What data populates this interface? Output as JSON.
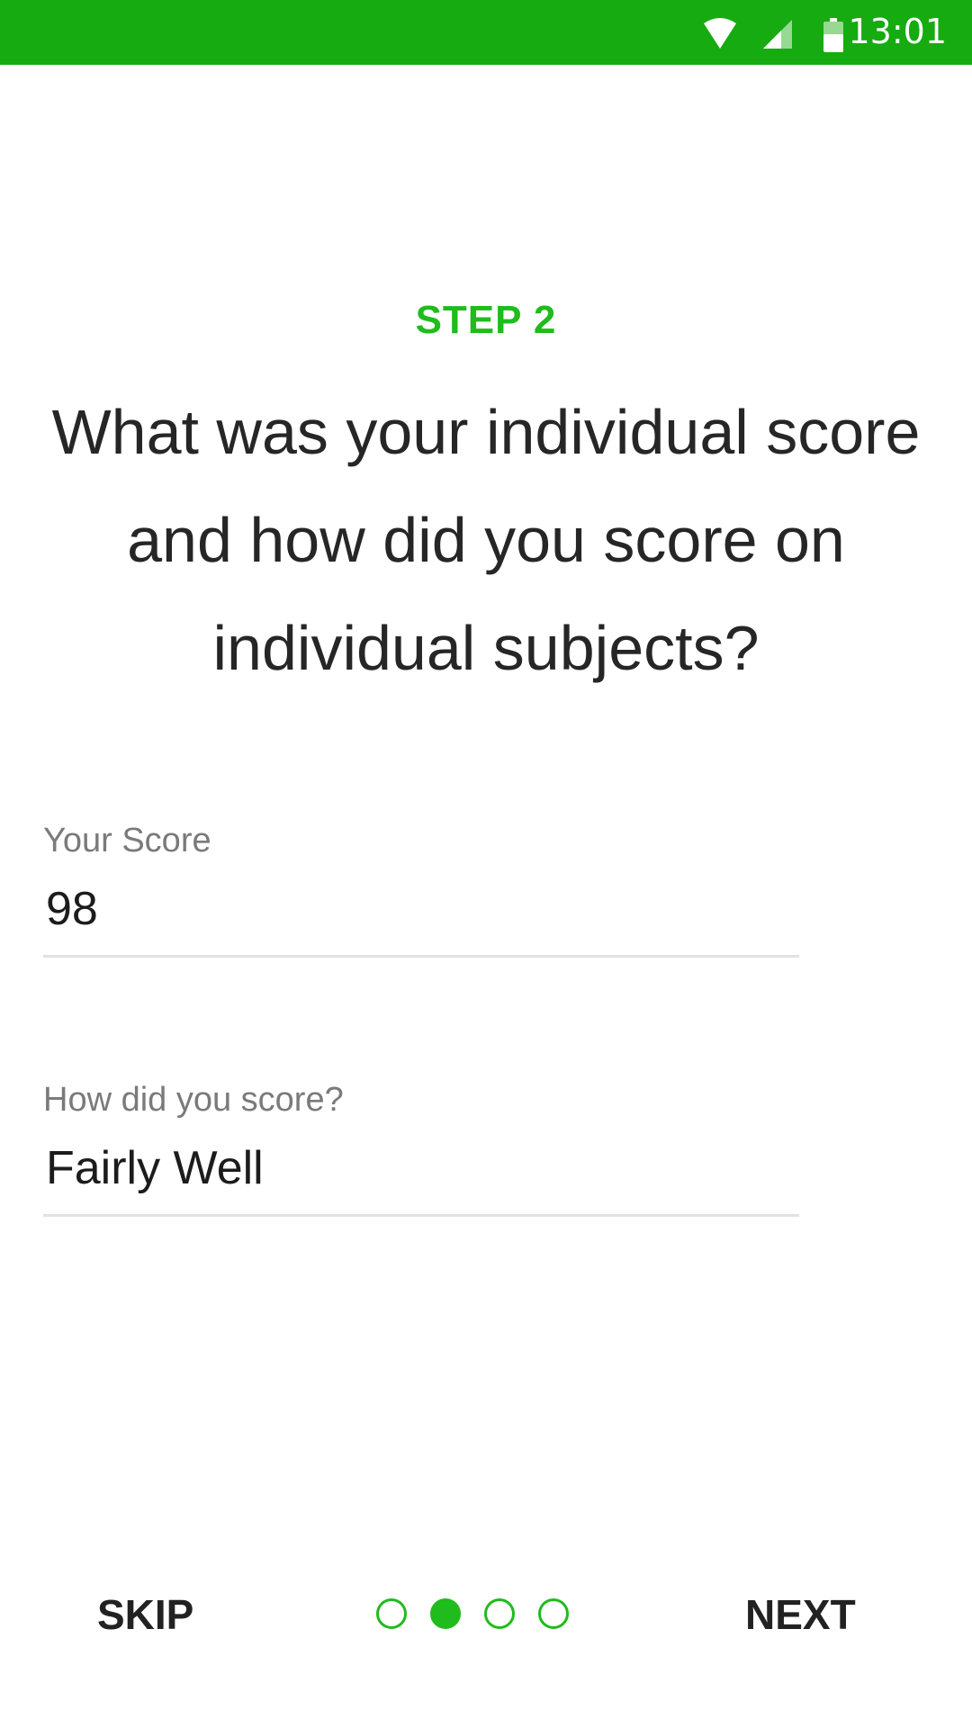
{
  "status_bar": {
    "time": "13:01",
    "icons": [
      "wifi-icon",
      "signal-icon",
      "battery-icon"
    ],
    "color": "#16ab10"
  },
  "step": {
    "label": "STEP 2",
    "color": "#1fbc1c"
  },
  "question": "What was your individual score and how did you score on individual subjects?",
  "form": {
    "score": {
      "label": "Your Score",
      "value": "98"
    },
    "how": {
      "label": "How did you score?",
      "value": "Fairly Well"
    }
  },
  "navigation": {
    "skip_label": "SKIP",
    "next_label": "NEXT",
    "pager": {
      "total": 4,
      "current": 2
    }
  }
}
